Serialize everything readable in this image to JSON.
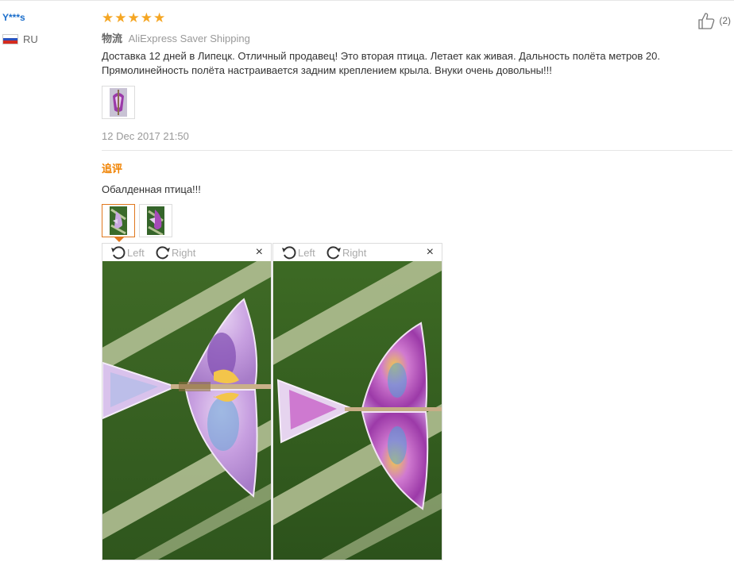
{
  "user": {
    "name": "Y***s",
    "country": "RU",
    "flag_colors": [
      "#ffffff",
      "#2a52be",
      "#d52b1e"
    ]
  },
  "rating": {
    "stars": 5,
    "star_glyph": "★",
    "color": "#f5a623"
  },
  "helpful": {
    "count_label": "(2)"
  },
  "shipping": {
    "label": "物流",
    "value": "AliExpress Saver Shipping"
  },
  "review": {
    "text": "Доставка 12 дней в Липецк. Отличный продавец! Это вторая птица. Летает как живая. Дальность полёта метров 20. Прямолинейность полёта настраивается задним креплением крыла. Внуки очень довольны!!!",
    "date": "12 Dec 2017 21:50"
  },
  "followup": {
    "title": "追评",
    "text": "Обалденная птица!!!"
  },
  "viewer": {
    "left_label": "Left",
    "right_label": "Right",
    "close_glyph": "×"
  },
  "colors": {
    "link": "#1b6ecb",
    "accent": "#f08200",
    "muted": "#999999"
  }
}
